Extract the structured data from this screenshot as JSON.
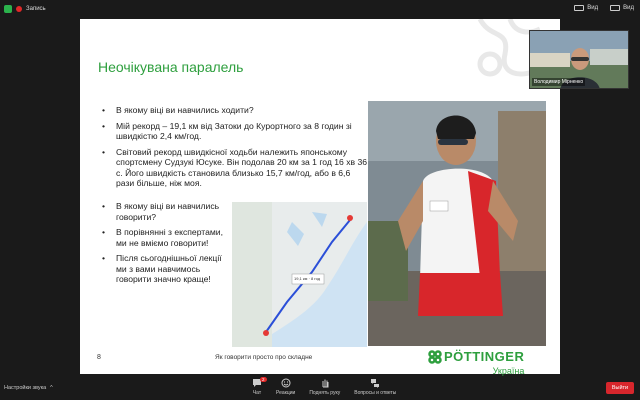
{
  "topbar": {
    "recording_label": "Запись",
    "view_label": "Вид",
    "hide_label": "Вид"
  },
  "slide": {
    "title": "Неочікувана паралель",
    "bullets": [
      "В якому віці ви навчились ходити?",
      "Мій рекорд – 19,1 км від Затоки до Курортного за 8 годин зі швидкістю 2,4 км/год.",
      "Світовий рекорд швидкісної ходьби належить японському спортсмену Судзукі Юсуке. Він подолав 20 км за 1 год 16 хв 36 с. Його швидкість становила близько 15,7 км/год, або в 6,6 рази більше, ніж моя."
    ],
    "bullets2": [
      "В якому віці ви навчились говорити?",
      "В порівнянні з експертами, ми не вміємо говорити!",
      "Після сьогоднішньої лекції ми з вами навчимось говорити значно краще!"
    ],
    "map_label": "19,1 км · 8 год",
    "page_number": "8",
    "footer_text": "Як говорити просто про складне",
    "logo_text": "PÖTTINGER",
    "logo_sub": "Україна"
  },
  "participant": {
    "name": "Володимир Мірненко"
  },
  "bottombar": {
    "sound_label": "Настройки звука",
    "controls": [
      {
        "label": "Чат",
        "icon": "chat-icon",
        "badge": "2"
      },
      {
        "label": "Реакции",
        "icon": "reaction-icon"
      },
      {
        "label": "Поднять руку",
        "icon": "hand-icon"
      },
      {
        "label": "Вопросы и ответы",
        "icon": "qa-icon"
      }
    ],
    "exit_label": "Выйти"
  },
  "colors": {
    "accent_green": "#2e9f3e",
    "exit_red": "#d7262c",
    "record_red": "#e02828"
  }
}
